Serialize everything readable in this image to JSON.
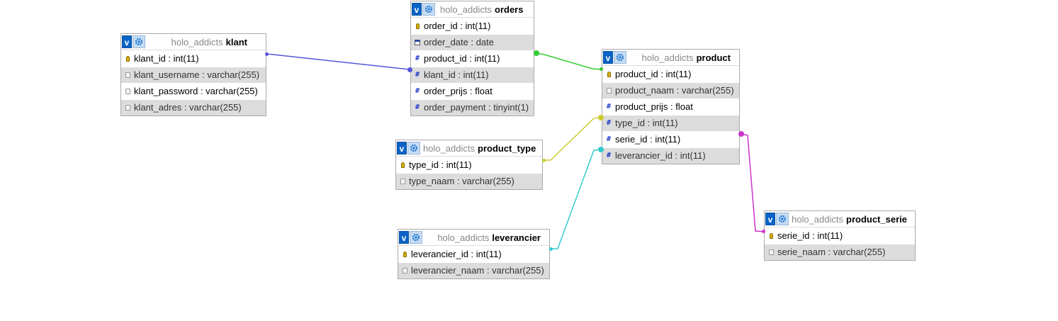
{
  "colors": {
    "klant_orders": "#5555dd",
    "orders_product": "#33cc33",
    "product_type_product": "#cccc33",
    "leverancier_product": "#33cccc",
    "product_serie_product": "#cc33cc"
  },
  "tables": {
    "klant": {
      "db": "holo_addicts",
      "name": "klant",
      "fields": [
        {
          "label": "klant_id : int(11)",
          "icon": "key-icon"
        },
        {
          "label": "klant_username : varchar(255)",
          "icon": "text-icon"
        },
        {
          "label": "klant_password : varchar(255)",
          "icon": "text-icon"
        },
        {
          "label": "klant_adres : varchar(255)",
          "icon": "text-icon"
        }
      ]
    },
    "orders": {
      "db": "holo_addicts",
      "name": "orders",
      "fields": [
        {
          "label": "order_id : int(11)",
          "icon": "key-icon"
        },
        {
          "label": "order_date : date",
          "icon": "date-icon"
        },
        {
          "label": "product_id : int(11)",
          "icon": "number-icon"
        },
        {
          "label": "klant_id : int(11)",
          "icon": "number-icon"
        },
        {
          "label": "order_prijs : float",
          "icon": "number-icon"
        },
        {
          "label": "order_payment : tinyint(1)",
          "icon": "number-icon"
        }
      ]
    },
    "product": {
      "db": "holo_addicts",
      "name": "product",
      "fields": [
        {
          "label": "product_id : int(11)",
          "icon": "key-icon"
        },
        {
          "label": "product_naam : varchar(255)",
          "icon": "text-icon"
        },
        {
          "label": "product_prijs : float",
          "icon": "number-icon"
        },
        {
          "label": "type_id : int(11)",
          "icon": "number-icon"
        },
        {
          "label": "serie_id : int(11)",
          "icon": "number-icon"
        },
        {
          "label": "leverancier_id : int(11)",
          "icon": "number-icon"
        }
      ]
    },
    "product_type": {
      "db": "holo_addicts",
      "name": "product_type",
      "fields": [
        {
          "label": "type_id : int(11)",
          "icon": "key-icon"
        },
        {
          "label": "type_naam : varchar(255)",
          "icon": "text-icon"
        }
      ]
    },
    "leverancier": {
      "db": "holo_addicts",
      "name": "leverancier",
      "fields": [
        {
          "label": "leverancier_id : int(11)",
          "icon": "key-icon"
        },
        {
          "label": "leverancier_naam : varchar(255)",
          "icon": "text-icon"
        }
      ]
    },
    "product_serie": {
      "db": "holo_addicts",
      "name": "product_serie",
      "fields": [
        {
          "label": "serie_id : int(11)",
          "icon": "key-icon"
        },
        {
          "label": "serie_naam : varchar(255)",
          "icon": "text-icon"
        }
      ]
    }
  },
  "header_buttons": {
    "toggle_label": "v",
    "options_icon": "gear-icon"
  }
}
